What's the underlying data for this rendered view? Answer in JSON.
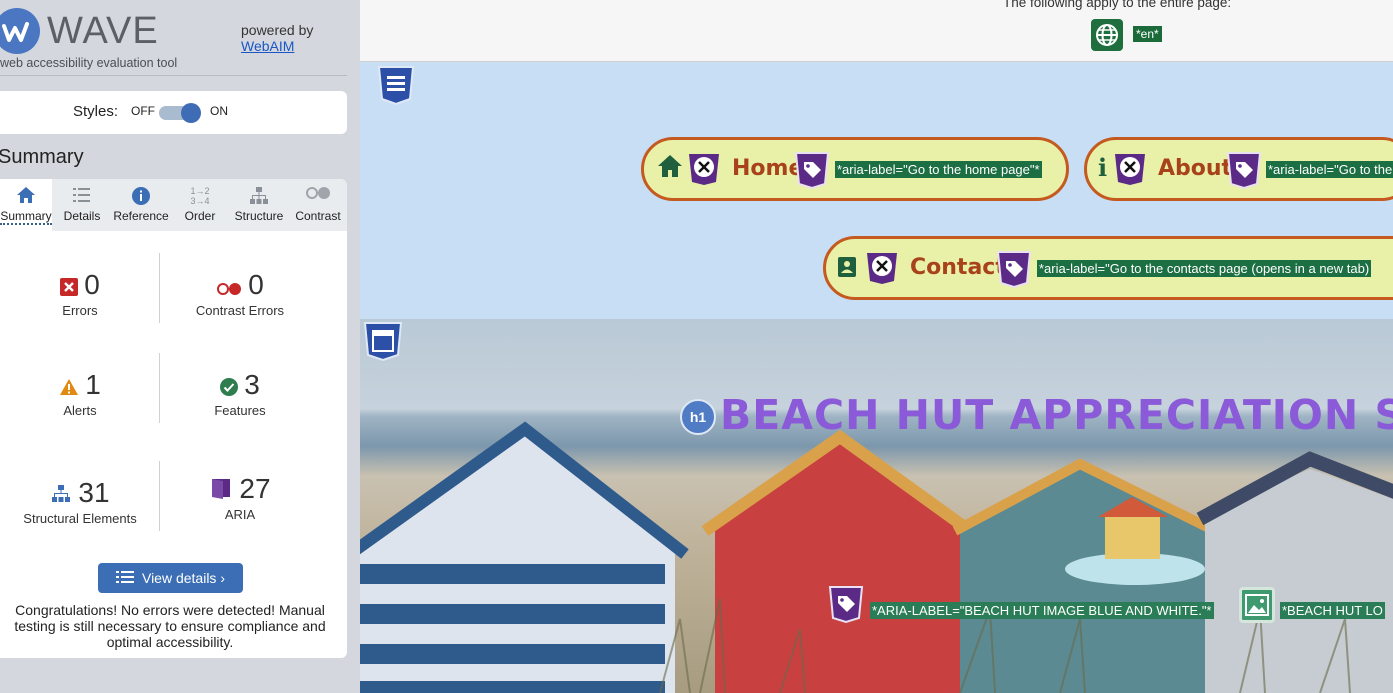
{
  "sidebar": {
    "title": "WAVE",
    "tagline": "web accessibility evaluation tool",
    "powered_by": "powered by",
    "webaim": "WebAIM",
    "styles_label": "Styles:",
    "off": "OFF",
    "on": "ON",
    "summary_heading": "Summary",
    "tabs": [
      {
        "label": "Summary",
        "icon": "home-icon"
      },
      {
        "label": "Details",
        "icon": "list-icon"
      },
      {
        "label": "Reference",
        "icon": "info-icon"
      },
      {
        "label": "Order",
        "icon": "order-icon"
      },
      {
        "label": "Structure",
        "icon": "structure-icon"
      },
      {
        "label": "Contrast",
        "icon": "contrast-icon"
      }
    ],
    "stats": {
      "errors": {
        "count": "0",
        "label": "Errors"
      },
      "contrast_errors": {
        "count": "0",
        "label": "Contrast Errors"
      },
      "alerts": {
        "count": "1",
        "label": "Alerts"
      },
      "features": {
        "count": "3",
        "label": "Features"
      },
      "structural": {
        "count": "31",
        "label": "Structural Elements"
      },
      "aria": {
        "count": "27",
        "label": "ARIA"
      }
    },
    "view_details": "View details ›",
    "congrats": "Congratulations! No errors were detected! Manual testing is still necessary to ensure compliance and optimal accessibility."
  },
  "page": {
    "top_note": "The following apply to the entire page:",
    "lang": "*en*",
    "nav": {
      "home": {
        "label": "Home",
        "aria": "*aria-label=\"Go to the home page\"*"
      },
      "about": {
        "label": "About",
        "aria": "*aria-label=\"Go to the"
      },
      "contact": {
        "label": "Contact",
        "aria": "*aria-label=\"Go to the contacts page (opens in a new tab)"
      }
    },
    "h1_badge": "h1",
    "hero_title": "BEACH HUT APPRECIATION S",
    "img_aria": "*ARIA-LABEL=\"BEACH HUT IMAGE BLUE AND WHITE.\"*",
    "img_alt": "*BEACH HUT LO"
  },
  "colors": {
    "accent": "#3b6eb4",
    "nav_border": "#c45a1f",
    "aria_tag": "#1c6e43",
    "aria_purple": "#5b2a86"
  }
}
